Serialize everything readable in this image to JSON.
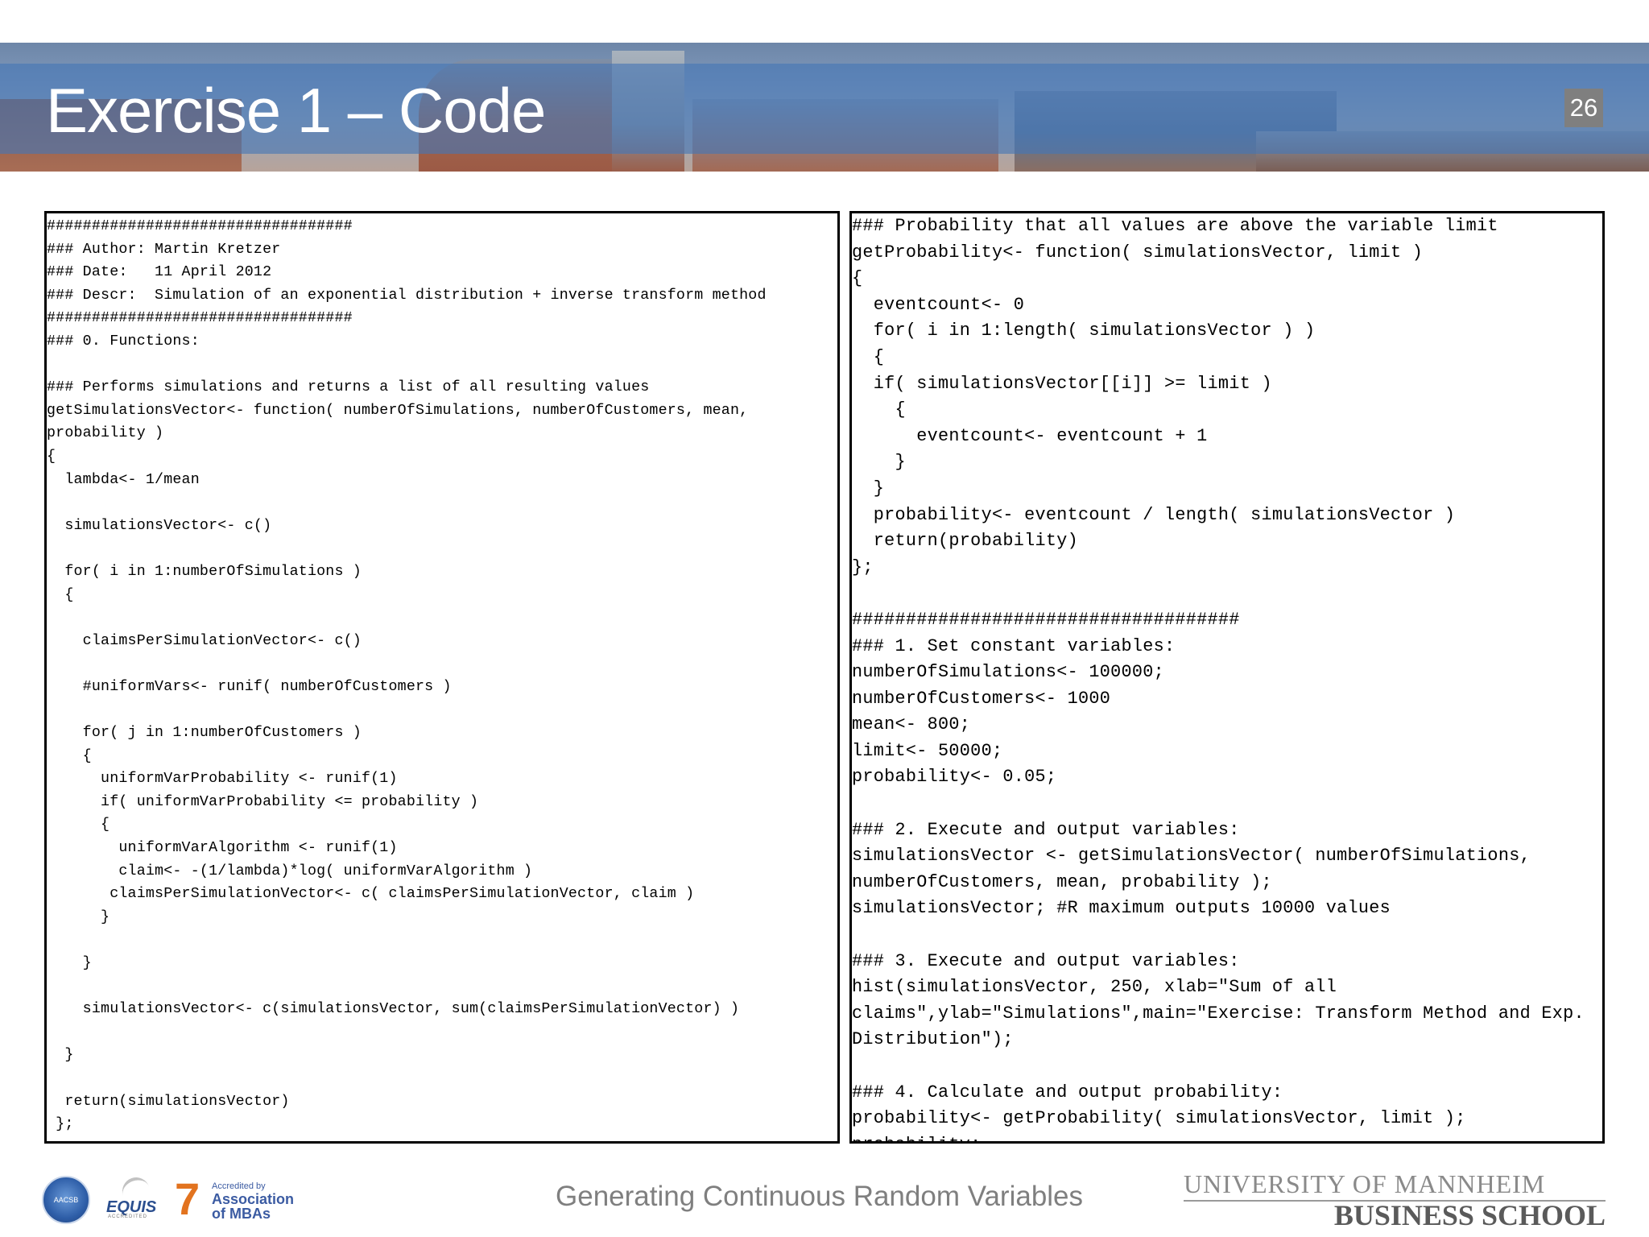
{
  "slide": {
    "title": "Exercise 1 – Code",
    "page_number": "26",
    "footer_title": "Generating Continuous Random Variables"
  },
  "code_left": [
    "##################################",
    "### Author: Martin Kretzer",
    "### Date:   11 April 2012",
    "### Descr:  Simulation of an exponential distribution + inverse transform method",
    "##################################",
    "### 0. Functions:",
    "",
    "### Performs simulations and returns a list of all resulting values",
    "getSimulationsVector<- function( numberOfSimulations, numberOfCustomers, mean,",
    "probability )",
    "{",
    "  lambda<- 1/mean",
    "",
    "  simulationsVector<- c()",
    "",
    "  for( i in 1:numberOfSimulations )",
    "  {",
    "",
    "    claimsPerSimulationVector<- c()",
    "",
    "    #uniformVars<- runif( numberOfCustomers )",
    "",
    "    for( j in 1:numberOfCustomers )",
    "    {",
    "      uniformVarProbability <- runif(1)",
    "      if( uniformVarProbability <= probability )",
    "      {",
    "        uniformVarAlgorithm <- runif(1)",
    "        claim<- -(1/lambda)*log( uniformVarAlgorithm )",
    "       claimsPerSimulationVector<- c( claimsPerSimulationVector, claim )",
    "      }",
    "",
    "    }",
    "",
    "    simulationsVector<- c(simulationsVector, sum(claimsPerSimulationVector) )",
    "",
    "  }",
    "",
    "  return(simulationsVector)",
    " };"
  ],
  "code_right": [
    "### Probability that all values are above the variable limit",
    "getProbability<- function( simulationsVector, limit )",
    "{",
    "  eventcount<- 0",
    "  for( i in 1:length( simulationsVector ) )",
    "  {",
    "  if( simulationsVector[[i]] >= limit )",
    "    {",
    "      eventcount<- eventcount + 1",
    "    }",
    "  }",
    "  probability<- eventcount / length( simulationsVector )",
    "  return(probability)",
    "};",
    "",
    "####################################",
    "### 1. Set constant variables:",
    "numberOfSimulations<- 100000;",
    "numberOfCustomers<- 1000",
    "mean<- 800;",
    "limit<- 50000;",
    "probability<- 0.05;",
    "",
    "### 2. Execute and output variables:",
    "simulationsVector <- getSimulationsVector( numberOfSimulations,",
    "numberOfCustomers, mean, probability );",
    "simulationsVector; #R maximum outputs 10000 values",
    "",
    "### 3. Execute and output variables:",
    "hist(simulationsVector, 250, xlab=\"Sum of all",
    "claims\",ylab=\"Simulations\",main=\"Exercise: Transform Method and Exp.",
    "Distribution\");",
    "",
    "### 4. Calculate and output probability:",
    "probability<- getProbability( simulationsVector, limit );",
    "probability;"
  ],
  "logos": {
    "aacsb": "AACSB",
    "equis": "EQUIS",
    "equis_sub": "ACCREDITED",
    "amba_top": "Accredited by",
    "amba_mid": "Association",
    "amba_bottom": "of MBAs",
    "university_line1": "UNIVERSITY OF MANNHEIM",
    "university_line2": "BUSINESS SCHOOL"
  },
  "colors": {
    "banner_band": "#4676b4",
    "page_number_bg": "#7f7f7f",
    "footer_text": "#7f7f7f"
  }
}
